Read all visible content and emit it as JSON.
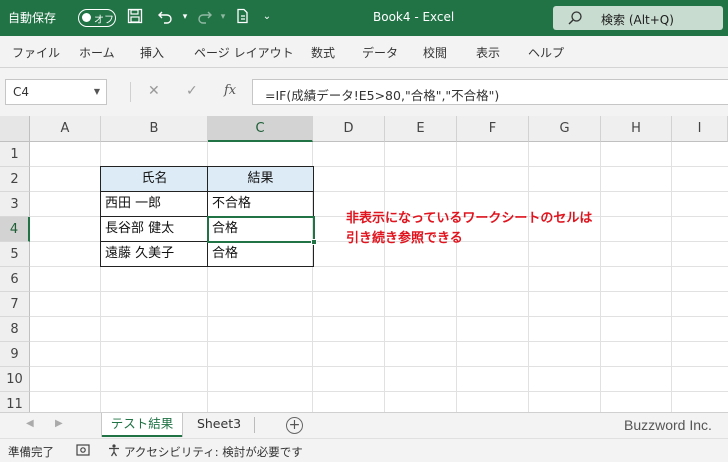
{
  "titlebar": {
    "autosave_label": "自動保存",
    "toggle_label": "オフ",
    "doc_title": "Book4  -  Excel",
    "search_placeholder": "検索 (Alt+Q)"
  },
  "ribbon": {
    "tabs": [
      "ファイル",
      "ホーム",
      "挿入",
      "ページ レイアウト",
      "数式",
      "データ",
      "校閲",
      "表示",
      "ヘルプ"
    ]
  },
  "formula_bar": {
    "name_box": "C4",
    "fx_label": "fx",
    "formula": "=IF(成績データ!E5>80,\"合格\",\"不合格\")"
  },
  "sheet": {
    "columns": [
      "A",
      "B",
      "C",
      "D",
      "E",
      "F",
      "G",
      "H",
      "I"
    ],
    "rows": [
      "1",
      "2",
      "3",
      "4",
      "5",
      "6",
      "7",
      "8",
      "9",
      "10",
      "11"
    ],
    "active_cell": "C4",
    "table": {
      "headers": [
        "氏名",
        "結果"
      ],
      "rows": [
        [
          "西田 一郎",
          "不合格"
        ],
        [
          "長谷部 健太",
          "合格"
        ],
        [
          "遠藤 久美子",
          "合格"
        ]
      ]
    },
    "note_lines": [
      "非表示になっているワークシートのセルは",
      "引き続き参照できる"
    ],
    "note_color": "#e0141e"
  },
  "sheet_tabs": {
    "tabs": [
      "テスト結果",
      "Sheet3"
    ],
    "active": "テスト結果",
    "add_label": "+",
    "watermark": "Buzzword Inc."
  },
  "status_bar": {
    "ready": "準備完了",
    "accessibility": "アクセシビリティ: 検討が必要です"
  },
  "colors": {
    "excel_green": "#217346",
    "header_fill": "#ddebf7"
  }
}
